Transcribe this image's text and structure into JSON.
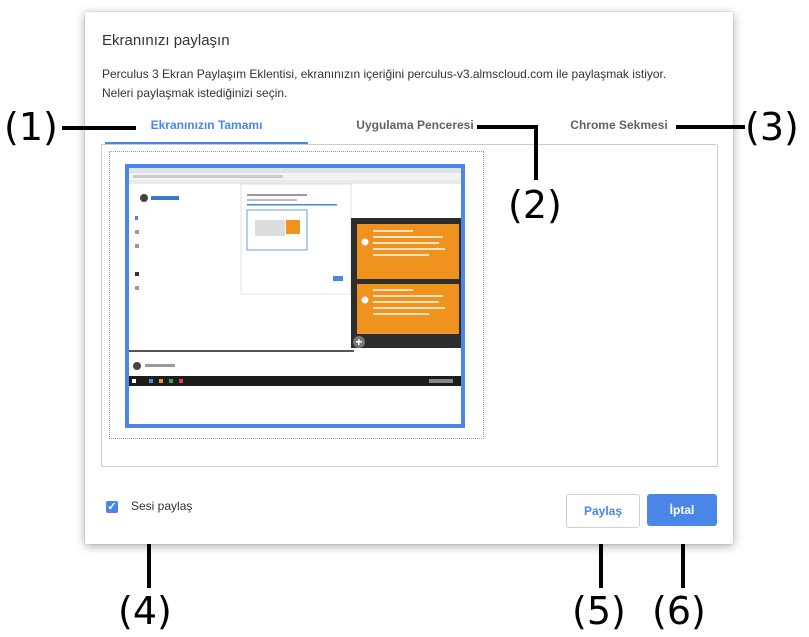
{
  "dialog": {
    "title": "Ekranınızı paylaşın",
    "description_line1": "Perculus 3 Ekran Paylaşım Eklentisi, ekranınızın içeriğini perculus-v3.almscloud.com ile paylaşmak istiyor.",
    "description_line2": "Neleri paylaşmak istediğinizi seçin.",
    "tabs": [
      {
        "label": "Ekranınızın Tamamı",
        "active": true
      },
      {
        "label": "Uygulama Penceresi",
        "active": false
      },
      {
        "label": "Chrome Sekmesi",
        "active": false
      }
    ],
    "audio_checkbox": {
      "label": "Sesi paylaş",
      "checked": true
    },
    "buttons": {
      "share": "Paylaş",
      "cancel": "İptal"
    }
  },
  "callouts": [
    "(1)",
    "(2)",
    "(3)",
    "(4)",
    "(5)",
    "(6)"
  ],
  "colors": {
    "accent": "#4a86e8",
    "preview_orange": "#f0921e",
    "taskbar": "#1c1c1c"
  }
}
